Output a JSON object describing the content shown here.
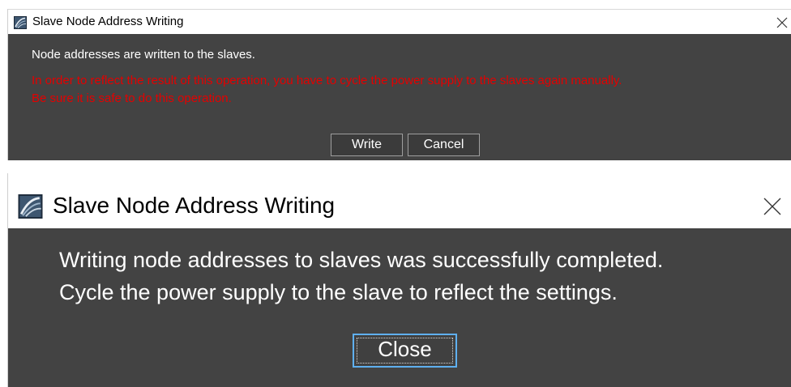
{
  "dialog1": {
    "title": "Slave Node Address Writing",
    "title_icon": "app-icon",
    "close_icon": "close-icon",
    "message": "Node addresses are written to the slaves.",
    "warning_line1": "In order to reflect the result of this operation, you have to cycle the power supply to the slaves again manually.",
    "warning_line2": "Be sure it is safe to do this operation.",
    "write_label": "Write",
    "cancel_label": "Cancel"
  },
  "dialog2": {
    "title": "Slave Node Address Writing",
    "title_icon": "app-icon",
    "close_icon": "close-icon",
    "message_line1": "Writing node addresses to slaves was successfully completed.",
    "message_line2": "Cycle the power supply to the slave to reflect the settings.",
    "close_label": "Close"
  },
  "colors": {
    "body_bg": "#434343",
    "warning_text": "#e40000",
    "focus_border": "#5fb0f0"
  }
}
